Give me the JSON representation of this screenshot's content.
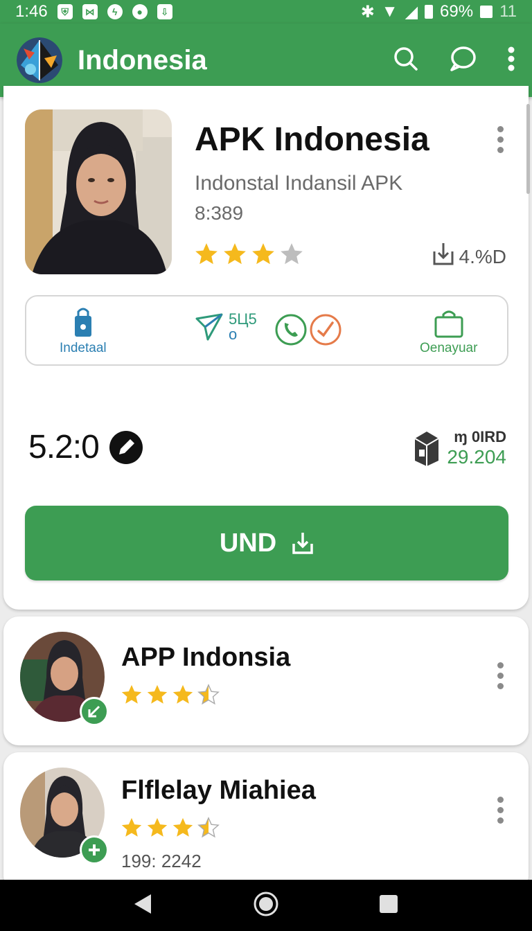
{
  "status_bar": {
    "time": "1:46",
    "battery": "69%",
    "signal_extra": "11"
  },
  "app_bar": {
    "title": "Indonesia"
  },
  "hero": {
    "title": "APK Indonesia",
    "subtitle": "Indonstal Indansil APK",
    "number": "8:389",
    "rating_stars": 3,
    "size": "4.%D",
    "features": [
      {
        "label": "Indetaal",
        "icon": "lock-icon"
      },
      {
        "label": "5Ц5",
        "sub": "o",
        "icon": "send-icon"
      },
      {
        "label": "",
        "icon": "call-icon"
      },
      {
        "label": "",
        "icon": "check-icon"
      },
      {
        "label": "Oenayuar",
        "icon": "shopping-bag-icon"
      }
    ],
    "version": "5.2:0",
    "download_label": "ɱ 0IRD",
    "download_value": "29.204",
    "install_label": "UND"
  },
  "list": [
    {
      "title": "APP Indonsia",
      "rating": 3.5,
      "meta": "",
      "badge": "arrow-icon"
    },
    {
      "title": "Flflelay Miahiea",
      "rating": 3.5,
      "meta": "199: 2242",
      "badge": "plus-icon"
    }
  ],
  "colors": {
    "primary": "#3d9d53",
    "star": "#f5b91d",
    "star_empty": "#bdbdbd"
  }
}
